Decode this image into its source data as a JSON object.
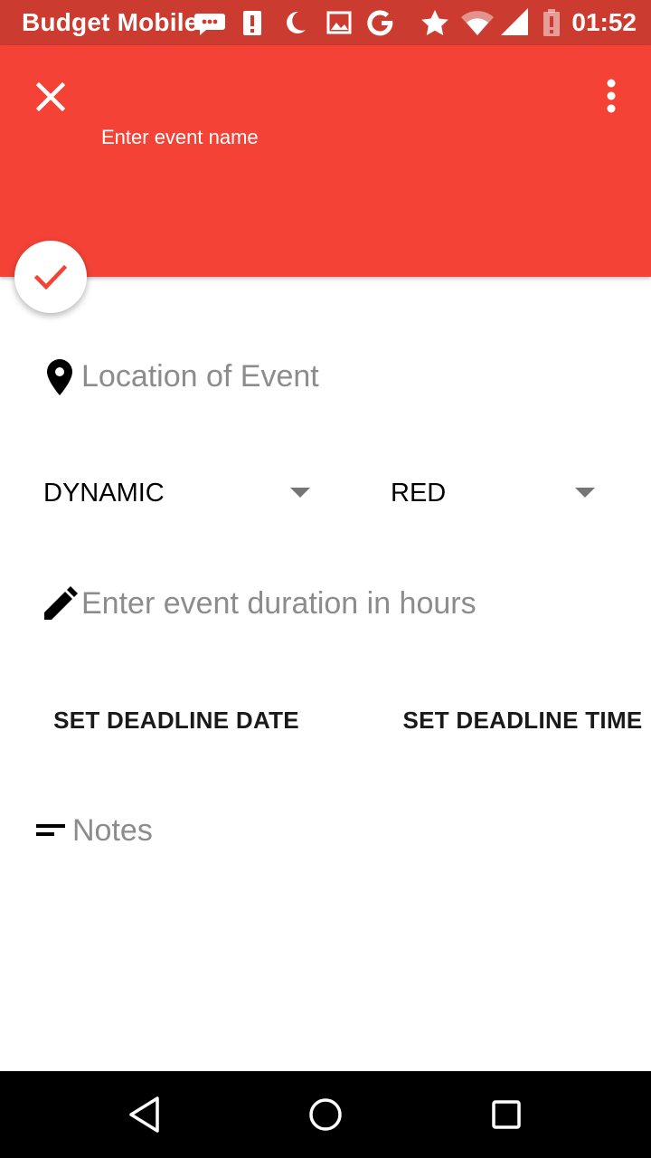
{
  "status_bar": {
    "carrier": "Budget Mobile",
    "time": "01:52",
    "icons": [
      "message-icon",
      "alert-icon",
      "moon-icon",
      "image-icon",
      "google-icon",
      "star-icon",
      "wifi-icon",
      "signal-icon",
      "battery-alert-icon"
    ]
  },
  "app_bar": {
    "color": "#f44336",
    "close_icon": "close-icon",
    "menu_icon": "more-vert-icon",
    "event_name_placeholder": "Enter event name"
  },
  "fab": {
    "icon": "check-icon",
    "icon_color": "#f44336"
  },
  "form": {
    "location_placeholder": "Location of Event",
    "location_icon": "location-pin-icon",
    "type_spinner_value": "DYNAMIC",
    "color_spinner_value": "RED",
    "duration_placeholder": "Enter event duration in hours",
    "duration_icon": "pencil-icon",
    "deadline_date_label": "SET DEADLINE DATE",
    "deadline_time_label": "SET DEADLINE TIME",
    "notes_placeholder": "Notes",
    "notes_icon": "notes-icon"
  },
  "nav_bar": {
    "back_icon": "back-icon",
    "home_icon": "home-icon",
    "recents_icon": "recents-icon"
  }
}
